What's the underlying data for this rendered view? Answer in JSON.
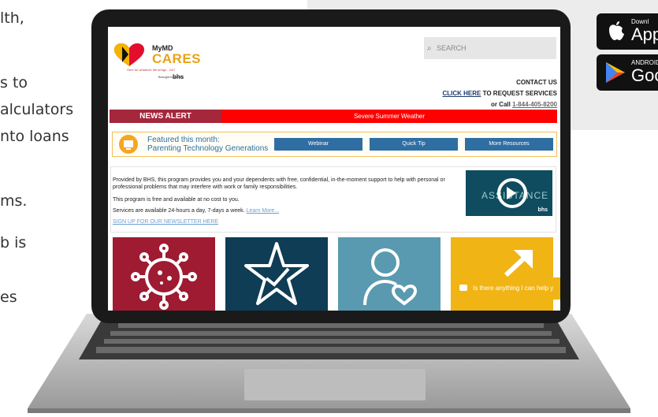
{
  "background_text": [
    "lth,",
    "s to",
    "alculators",
    "nto loans",
    "ms.",
    "b is",
    "es"
  ],
  "store_buttons": {
    "apple": {
      "small": "Downl",
      "big": "App",
      "icon": "apple-icon"
    },
    "google": {
      "small": "ANDROID A",
      "big": "Goo",
      "icon": "play-store-icon"
    }
  },
  "site": {
    "logo": {
      "line1": "MyMD",
      "line2": "CARES",
      "tagline": "Here for whatever life brings - 24/7",
      "brought": "Brought to you by",
      "brand": "bhs"
    },
    "search": {
      "placeholder": "SEARCH"
    },
    "contact": {
      "title": "CONTACT US",
      "click_here": "CLICK HERE",
      "request": " TO REQUEST SERVICES",
      "or_call": "or Call ",
      "phone": "1-844-405-8200"
    },
    "alert": {
      "label": "NEWS ALERT",
      "message": "Severe Summer Weather"
    },
    "featured": {
      "line1": "Featured this month:",
      "line2": "Parenting Technology Generations",
      "buttons": [
        "Webinar",
        "Quick Tip",
        "More Resources"
      ]
    },
    "info": {
      "p1": "Provided by BHS, this program provides you and your dependents with free, confidential, in-the-moment support to help with personal or professional problems that may interfere with work or family responsibilities.",
      "p2": "This program is free and available at no cost to you.",
      "p3": "Services are available 24-hours a day, 7-days a week.",
      "learn_more": "Learn More...",
      "newsletter": "SIGN UP FOR OUR NEWSLETTER HERE"
    },
    "assistance": {
      "word": "ASSISTANCE",
      "brand": "bhs"
    },
    "tiles": [
      {
        "icon": "virus-icon",
        "color": "#9e1b32"
      },
      {
        "icon": "star-icon",
        "color": "#0e3d55"
      },
      {
        "icon": "person-heart-icon",
        "color": "#5a9ab0"
      },
      {
        "icon": "arrow-icon",
        "color": "#f0b414"
      }
    ],
    "tile_tm": "TM",
    "chat": {
      "text": "Is there anything I can help y"
    }
  }
}
